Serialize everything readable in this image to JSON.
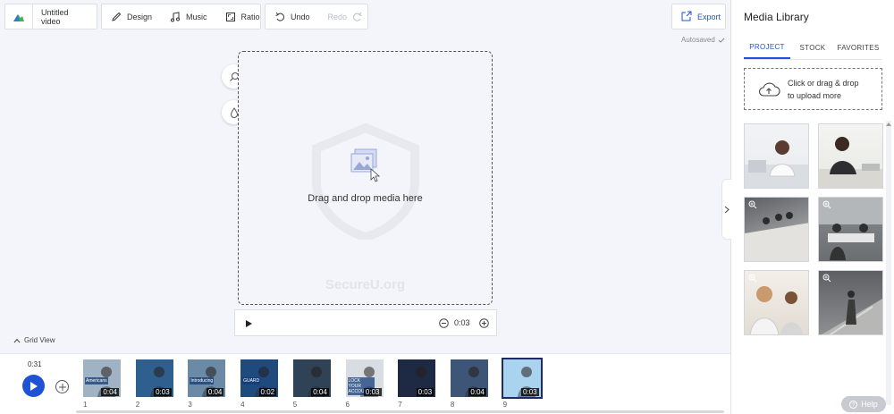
{
  "toolbar": {
    "title": "Untitled video",
    "design": "Design",
    "music": "Music",
    "ratio": "Ratio",
    "undo": "Undo",
    "redo": "Redo",
    "export": "Export",
    "autosaved": "Autosaved"
  },
  "canvas": {
    "drop_text": "Drag and drop media here",
    "watermark": "SecureU.org"
  },
  "player": {
    "time": "0:03"
  },
  "timeline": {
    "grid_view": "Grid View",
    "total_time": "0:31",
    "scenes": [
      {
        "num": "1",
        "dur": "0:04",
        "caption": "Americans",
        "bg": "#9fb3c4"
      },
      {
        "num": "2",
        "dur": "0:03",
        "caption": "",
        "bg": "#2e5f8f"
      },
      {
        "num": "3",
        "dur": "0:04",
        "caption": "Introducing",
        "bg": "#6b8aa5"
      },
      {
        "num": "4",
        "dur": "0:02",
        "caption": "GUARD",
        "bg": "#1f4a7d"
      },
      {
        "num": "5",
        "dur": "0:04",
        "caption": "",
        "bg": "#2f4256"
      },
      {
        "num": "6",
        "dur": "0:03",
        "caption": "LOCK YOUR ACCOUNTS",
        "bg": "#d8dde4"
      },
      {
        "num": "7",
        "dur": "0:03",
        "caption": "",
        "bg": "#1e2a44"
      },
      {
        "num": "8",
        "dur": "0:04",
        "caption": "",
        "bg": "#3d5576"
      },
      {
        "num": "9",
        "dur": "0:03",
        "caption": "",
        "bg": "#a9d3ee"
      }
    ]
  },
  "library": {
    "title": "Media Library",
    "tabs": [
      "PROJECT",
      "STOCK",
      "FAVORITES"
    ],
    "upload_line1": "Click or drag & drop",
    "upload_line2": "to upload more",
    "help": "Help"
  },
  "colors": {
    "accent": "#1f52d6",
    "play_button": "#1f52d6"
  }
}
